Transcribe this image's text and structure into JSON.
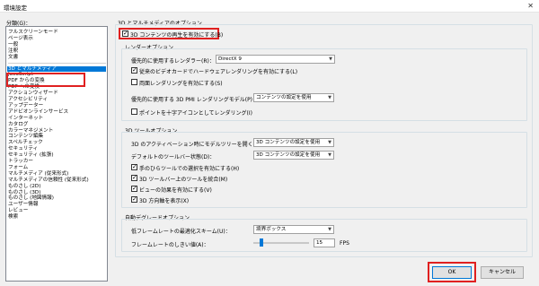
{
  "window": {
    "title": "環境設定",
    "close_glyph": "✕"
  },
  "categories": {
    "label": "分類(G)：",
    "group1": [
      "フルスクリーンモード",
      "ページ表示",
      "一般",
      "注釈",
      "文書"
    ],
    "group2": [
      "3D とマルチメディア",
      "JavaScript",
      "PDF からの変換",
      "PDF への変換",
      "アクションウィザード",
      "アクセシビリティ",
      "アップデーター",
      "アドビオンラインサービス",
      "インターネット",
      "カタログ",
      "カラーマネジメント",
      "コンテンツ編集",
      "スペルチェック",
      "セキュリティ",
      "セキュリティ (拡張)",
      "トラッカー",
      "フォーム",
      "マルチメディア (従来形式)",
      "マルチメディアの信頼性 (従来形式)",
      "ものさし (2D)",
      "ものさし (3D)",
      "ものさし (地図情報)",
      "ユーザー情報",
      "レビュー",
      "検索"
    ],
    "selected": "3D とマルチメディア"
  },
  "section_title": "3D とマルチメディアのオプション",
  "enable_3d": {
    "label": "3D コンテンツの再生を有効にする(B)",
    "checked": true
  },
  "rendering": {
    "title": "レンダーオプション",
    "renderer_label": "優先的に使用するレンダラー(R)：",
    "renderer_value": "DirectX 9",
    "hw_rendering": {
      "label": "従来のビデオカードでハードウェアレンダリングを有効にする(L)",
      "checked": true
    },
    "double_sided": {
      "label": "両面レンダリングを有効にする(S)",
      "checked": false
    },
    "pmi_label": "優先的に使用する 3D PMI レンダリングモデル(P)：",
    "pmi_value": "コンテンツの設定を使用",
    "crosshair": {
      "label": "ポイントを十字アイコンとしてレンダリング(I)",
      "checked": false
    }
  },
  "tools": {
    "title": "3D ツールオプション",
    "model_tree_label": "3D のアクティベーション時にモデルツリーを開く(E)：",
    "model_tree_value": "3D コンテンツの設定を使用",
    "toolbar_label": "デフォルトのツールバー状態(D)：",
    "toolbar_value": "3D コンテンツの設定を使用",
    "select_hand": {
      "label": "手のひらツールでの選択を有効にする(H)",
      "checked": true
    },
    "merge_toolbar": {
      "label": "3D ツールバー上のツールを統合(M)",
      "checked": true
    },
    "view_transitions": {
      "label": "ビューの効果を有効にする(V)",
      "checked": true
    },
    "show_direction": {
      "label": "3D 方向軸を表示(X)",
      "checked": true
    }
  },
  "degrade": {
    "title": "自動デグレードオプション",
    "low_fps_label": "低フレームレートの最適化スキーム(U)：",
    "low_fps_value": "境界ボックス",
    "threshold_label": "フレームレートのしきい値(A)：",
    "threshold_value": "15",
    "threshold_slider_fraction": 0.15,
    "fps_unit": "FPS"
  },
  "buttons": {
    "ok": "OK",
    "cancel": "キャンセル"
  }
}
